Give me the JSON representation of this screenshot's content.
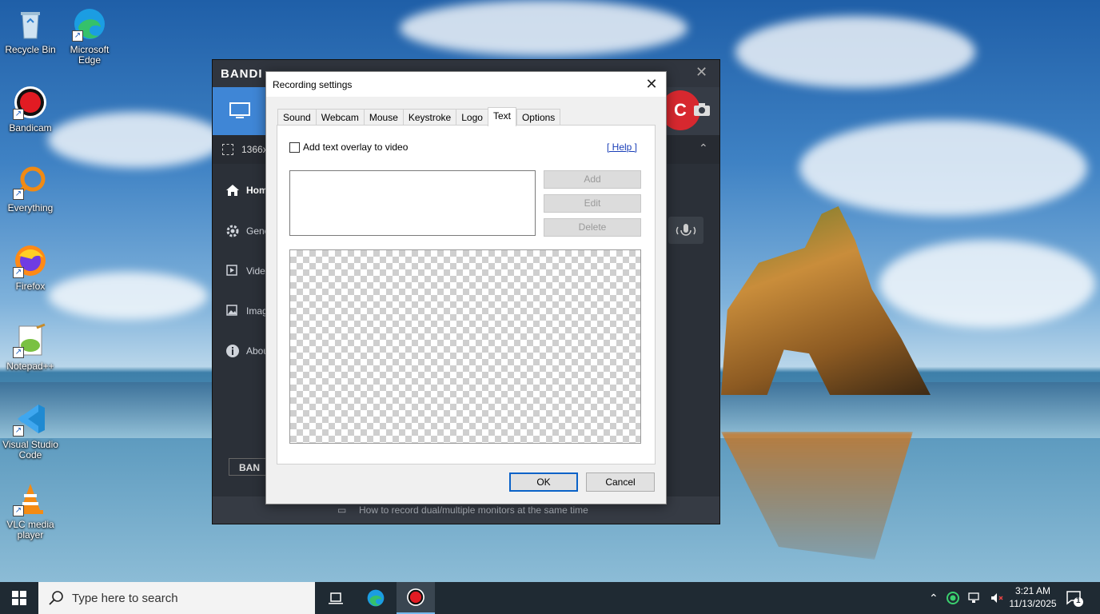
{
  "desktop": {
    "icons": [
      {
        "label": "Recycle Bin"
      },
      {
        "label": "Microsoft Edge"
      },
      {
        "label": "Bandicam"
      },
      {
        "label": "Everything"
      },
      {
        "label": "Firefox"
      },
      {
        "label": "Notepad++"
      },
      {
        "label": "Visual Studio Code"
      },
      {
        "label": "VLC media player"
      }
    ]
  },
  "bandicam": {
    "logo": "BANDI",
    "capture_size": "1366x",
    "rec_label": "C",
    "nav": [
      {
        "label": "Home"
      },
      {
        "label": "General"
      },
      {
        "label": "Video"
      },
      {
        "label": "Image"
      },
      {
        "label": "About"
      }
    ],
    "bottom_button": "BAN",
    "hint": "How to record dual/multiple monitors at the same time",
    "close": "✕"
  },
  "dialog": {
    "title": "Recording settings",
    "close": "✕",
    "tabs": [
      "Sound",
      "Webcam",
      "Mouse",
      "Keystroke",
      "Logo",
      "Text",
      "Options"
    ],
    "active_tab": "Text",
    "checkbox_label": "Add text overlay to video",
    "help_link": "[ Help ]",
    "buttons": {
      "add": "Add",
      "edit": "Edit",
      "delete": "Delete",
      "ok": "OK",
      "cancel": "Cancel"
    }
  },
  "taskbar": {
    "search_placeholder": "Type here to search",
    "time": "3:21 AM",
    "date": "11/13/2025",
    "notification_count": "1"
  },
  "colors": {
    "bandicam_accent": "#3f86d6",
    "record_red": "#d7282f",
    "link_blue": "#1a3fb8",
    "taskbar": "#1f2a33"
  }
}
